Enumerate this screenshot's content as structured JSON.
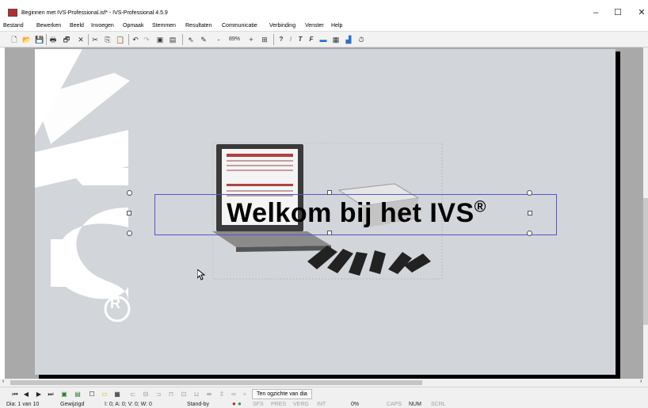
{
  "window": {
    "title": "Beginnen met IVS-Professional.isf* - IVS-Professional 4.5.9",
    "minimize": "–",
    "maximize": "☐",
    "close": "✕"
  },
  "menu": [
    "Bestand",
    "Bewerken",
    "Beeld",
    "Invoegen",
    "Opmaak",
    "Stemmen",
    "Resultaten",
    "Communicatie",
    "Verbinding",
    "Venster",
    "Help"
  ],
  "toolbar": {
    "zoom_minus": "-",
    "zoom_value": "89%",
    "zoom_plus": "+",
    "question": "?",
    "italic_i": "I",
    "text_t": "T",
    "format_f": "F"
  },
  "slide": {
    "title": "Welkom bij het IVS",
    "title_mark": "®"
  },
  "navbar": {
    "overview_button": "Ten ogzichte van dia"
  },
  "status": {
    "slide": "Dia: 1 van 10",
    "modified": "Gewijzigd",
    "counts": "I: 0;  A: 0;  V: 0;  W: 0",
    "mode": "Stand-by",
    "sfs": "SFS",
    "pres": "PRES",
    "verg": "VERG",
    "int": "INT",
    "percent": "0%",
    "caps": "CAPS",
    "num": "NUM",
    "scrl": "SCRL"
  },
  "colors": {
    "slide_background": "#d2d5d9",
    "workspace": "#a9a9a9",
    "selection": "#5555cc"
  }
}
